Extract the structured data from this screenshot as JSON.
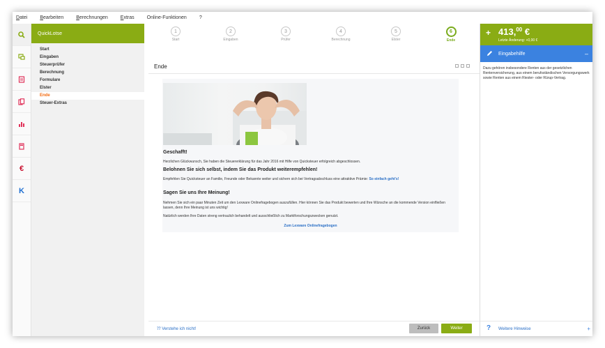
{
  "menu": [
    {
      "first": "D",
      "rest": "atei"
    },
    {
      "first": "B",
      "rest": "earbeiten"
    },
    {
      "first": "B",
      "rest": "erechnungen"
    },
    {
      "first": "E",
      "rest": "xtras"
    },
    {
      "first": "",
      "rest": "Online-Funktionen"
    },
    {
      "first": "",
      "rest": "?"
    }
  ],
  "iconbar": [
    {
      "name": "search-icon",
      "color": "#8aac14"
    },
    {
      "name": "monitor-icon",
      "color": "#8aac14"
    },
    {
      "name": "form-icon",
      "color": "#e0325a"
    },
    {
      "name": "documents-icon",
      "color": "#e0325a"
    },
    {
      "name": "bar-chart-icon",
      "color": "#e0325a"
    },
    {
      "name": "calculator-icon",
      "color": "#e0325a"
    },
    {
      "name": "euro-icon",
      "color": "#c8102e"
    },
    {
      "name": "k-icon",
      "color": "#1f6fd1"
    }
  ],
  "sidebar": {
    "title": "QuickLotse",
    "items": [
      "Start",
      "Eingaben",
      "Steuerprüfer",
      "Berechnung",
      "Formulare",
      "Elster",
      "Ende",
      "Steuer-Extras"
    ],
    "current": 6
  },
  "steps": [
    {
      "n": "1",
      "label": "Start"
    },
    {
      "n": "2",
      "label": "Eingaben"
    },
    {
      "n": "3",
      "label": "Prüfer"
    },
    {
      "n": "4",
      "label": "Berechnung"
    },
    {
      "n": "5",
      "label": "Elster"
    },
    {
      "n": "6",
      "label": "Ende"
    }
  ],
  "active_step": 5,
  "page": {
    "title": "Ende",
    "h1": "Geschafft!",
    "p1": "Herzlichen Glückwunsch, Sie haben die Steuererklärung für das Jahr 2016 mit Hilfe von Quicksteuer erfolgreich abgeschlossen.",
    "h2": "Belohnen Sie sich selbst, indem Sie das Produkt weiterempfehlen!",
    "p2": "Empfehlen Sie Quicksteuer an Familie, Freunde oder Bekannte weiter und sichern sich bei Vertragsabschluss eine attraktive Prämie:",
    "p2_link": "So einfach geht's!",
    "h3": "Sagen Sie uns Ihre Meinung!",
    "p3": "Nehmen Sie sich ein paar Minuten Zeit um den Lexware Onlinefragebogen auszufüllen. Hier können Sie das Produkt bewerten und Ihre Wünsche an die kommende Version einfließen lassen, denn Ihre Meinung ist uns wichtig!",
    "p4": "Natürlich werden Ihre Daten streng vertraulich behandelt und ausschließlich zu Marktforschungszwecken genutzt.",
    "survey_link": "Zum Lexware Onlinefragebogen"
  },
  "footer": {
    "help": "Verstehe ich nicht!",
    "back": "Zurück",
    "next": "Weiter"
  },
  "right": {
    "plus": "+",
    "amount_main": "413,",
    "amount_cents": "00",
    "currency": " €",
    "last_change": "Letzte Änderung: +0,00 €",
    "panel_title": "Eingabehilfe",
    "panel_text": "Dazu gehören insbesondere Renten aus der gesetzlichen Rentenversicherung, aus einem berufsständischen Versorgungswerk sowie Renten aus einem Riester- oder Rürup-Vertrag.",
    "more_help": "Weitere Hinweise"
  },
  "colors": {
    "accent": "#8aac14",
    "orange": "#f26a0f",
    "blue": "#3b82e0"
  }
}
